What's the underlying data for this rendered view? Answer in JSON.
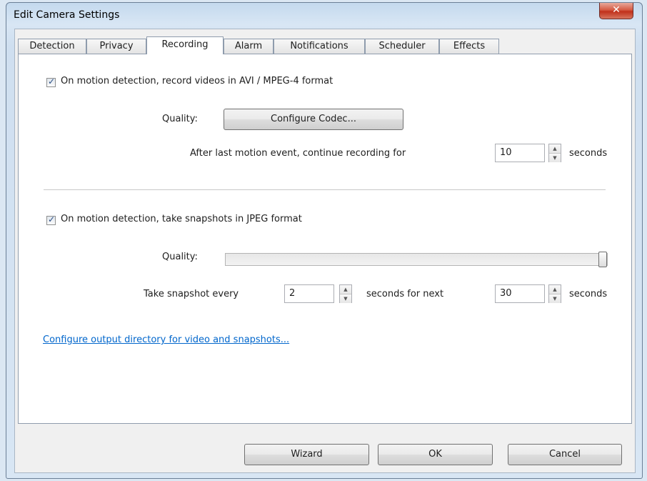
{
  "window": {
    "title": "Edit Camera Settings",
    "close_glyph": "✕"
  },
  "tabs": [
    {
      "label": "Detection"
    },
    {
      "label": "Privacy"
    },
    {
      "label": "Recording",
      "active": true
    },
    {
      "label": "Alarm"
    },
    {
      "label": "Notifications"
    },
    {
      "label": "Scheduler"
    },
    {
      "label": "Effects"
    }
  ],
  "video": {
    "checkbox_label": "On motion detection, record videos in AVI / MPEG-4 format",
    "checked": true,
    "quality_label": "Quality:",
    "codec_button": "Configure Codec...",
    "continue_label": "After last motion event, continue recording for",
    "continue_value": "10",
    "continue_unit": "seconds"
  },
  "snapshots": {
    "checkbox_label": "On motion detection, take snapshots in JPEG format",
    "checked": true,
    "quality_label": "Quality:",
    "quality_level": 1.0,
    "every_label": "Take snapshot every",
    "every_value": "2",
    "next_label": "seconds for next",
    "next_value": "30",
    "next_unit": "seconds"
  },
  "output_link": "Configure output directory for video and snapshots...",
  "buttons": {
    "wizard": "Wizard",
    "ok": "OK",
    "cancel": "Cancel"
  },
  "colors": {
    "link": "#0066cc",
    "close_button": "#c0301b"
  }
}
